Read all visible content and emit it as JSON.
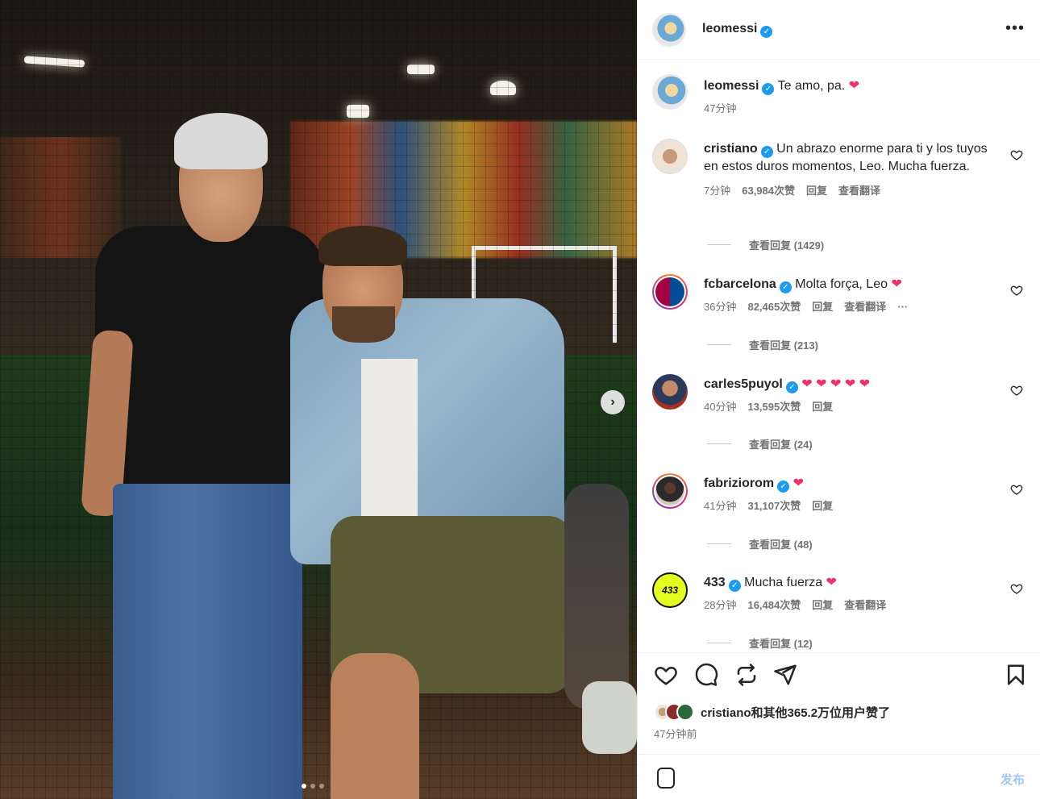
{
  "post": {
    "author": "leomessi",
    "slide_count": 3,
    "active_slide": 1
  },
  "caption": {
    "username": "leomessi",
    "text": "Te amo, pa.",
    "time": "47分钟"
  },
  "comments": [
    {
      "username": "cristiano",
      "text": "Un abrazo enorme para ti y los tuyos en estos duros momentos, Leo. Mucha fuerza.",
      "time": "7分钟",
      "likes": "63,984次赞",
      "reply_label": "回复",
      "translate_label": "查看翻译",
      "view_replies": "查看回复 (1429)"
    },
    {
      "username": "fcbarcelona",
      "text": "Molta força, Leo",
      "time": "36分钟",
      "likes": "82,465次赞",
      "reply_label": "回复",
      "translate_label": "查看翻译",
      "more": "···",
      "view_replies": "查看回复 (213)"
    },
    {
      "username": "carles5puyol",
      "text": "",
      "hearts": "❤ ❤ ❤ ❤ ❤",
      "time": "40分钟",
      "likes": "13,595次赞",
      "reply_label": "回复",
      "view_replies": "查看回复 (24)"
    },
    {
      "username": "fabriziorom",
      "text": "",
      "time": "41分钟",
      "likes": "31,107次赞",
      "reply_label": "回复",
      "view_replies": "查看回复 (48)"
    },
    {
      "username": "433",
      "avatar_text": "433",
      "text": "Mucha fuerza",
      "time": "28分钟",
      "likes": "16,484次赞",
      "reply_label": "回复",
      "translate_label": "查看翻译",
      "view_replies": "查看回复 (12)"
    }
  ],
  "likes_summary": "cristiano和其他365.2万位用户赞了",
  "posted_ago": "47分钟前",
  "add_comment": {
    "placeholder": "",
    "post_label": "发布"
  },
  "colors": {
    "verified": "#1d9bf0",
    "heart_emoji": "#f0306e",
    "post_button_disabled": "#a0c7f4",
    "text_primary": "#262626",
    "text_secondary": "#737373"
  },
  "icons": {
    "verified": "verified-badge-icon",
    "like": "heart-outline-icon",
    "comment": "speech-bubble-icon",
    "share": "repost-icon",
    "send": "paper-plane-icon",
    "save": "bookmark-icon",
    "more": "ellipsis-icon",
    "next": "chevron-right-icon"
  }
}
